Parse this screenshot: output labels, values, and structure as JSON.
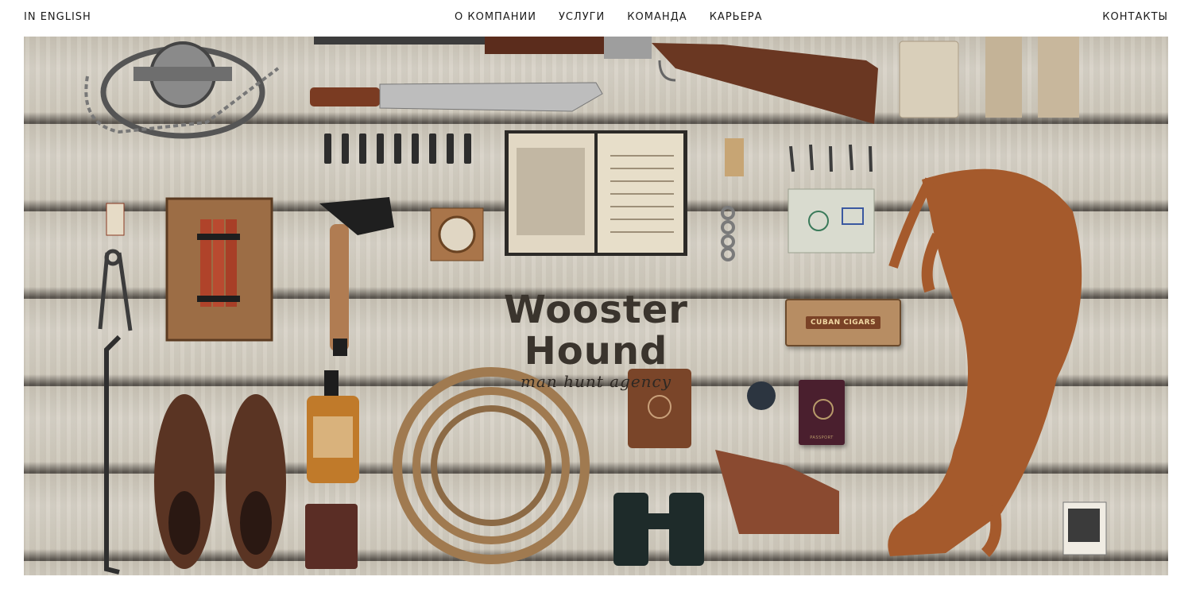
{
  "nav": {
    "left": "IN ENGLISH",
    "center": [
      "О КОМПАНИИ",
      "УСЛУГИ",
      "КОМАНДА",
      "КАРЬЕРА"
    ],
    "right": "КОНТАКТЫ"
  },
  "hero": {
    "title": "Wooster Hound",
    "tagline": "man hunt agency",
    "cigar_box_label": "CUBAN CIGARS",
    "passport_label": "PASSPORT"
  },
  "colors": {
    "wood": "#d2ccbf",
    "text": "#1a1a1a",
    "brand_text": "#3a342d"
  }
}
